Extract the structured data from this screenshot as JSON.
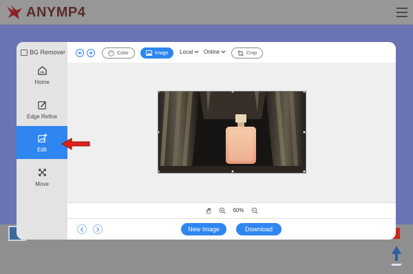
{
  "site": {
    "logo_text": "ANYMP4"
  },
  "sidebar": {
    "title": "BG Remover",
    "items": [
      {
        "label": "Home",
        "icon": "home-icon"
      },
      {
        "label": "Edge Refine",
        "icon": "edge-refine-icon"
      },
      {
        "label": "Edit",
        "icon": "edit-image-icon",
        "active": true
      },
      {
        "label": "Move",
        "icon": "move-icon"
      }
    ]
  },
  "toolbar": {
    "color_label": "Color",
    "image_label": "Image",
    "local_label": "Local",
    "online_label": "Online",
    "crop_label": "Crop"
  },
  "zoom": {
    "level": "60%"
  },
  "footer": {
    "new_image_label": "New Image",
    "download_label": "Download"
  },
  "colors": {
    "accent": "#2f86f0",
    "pointer": "#e0201b"
  }
}
